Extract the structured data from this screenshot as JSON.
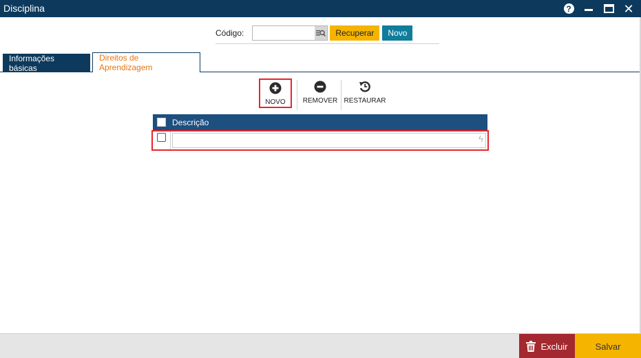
{
  "window": {
    "title": "Disciplina",
    "controls": [
      "help-icon",
      "minimize-icon",
      "maximize-icon",
      "close-icon"
    ]
  },
  "search": {
    "label": "Código:",
    "value": "",
    "placeholder": "",
    "lookup_icon": "lookup-icon",
    "recover_label": "Recuperar",
    "new_label": "Novo"
  },
  "tabs": [
    {
      "label": "Informações básicas",
      "active": false
    },
    {
      "label": "Direitos de Aprendizagem",
      "active": true
    }
  ],
  "toolbar": {
    "items": [
      {
        "label": "NOVO",
        "icon": "plus-circle-icon",
        "highlighted": true
      },
      {
        "label": "REMOVER",
        "icon": "minus-circle-icon"
      },
      {
        "label": "RESTAURAR",
        "icon": "restore-icon"
      }
    ]
  },
  "grid": {
    "columns": [
      "Descrição"
    ],
    "rows": [
      {
        "checked": false,
        "descricao": ""
      }
    ]
  },
  "footer": {
    "delete_label": "Excluir",
    "save_label": "Salvar"
  },
  "colors": {
    "titlebar": "#0d3a5c",
    "accent_yellow": "#f5b400",
    "accent_teal": "#0f7d9c",
    "grid_header": "#1d4f7f",
    "delete_red": "#a3282f",
    "active_tab_text": "#e87511",
    "highlight_red": "#e8242b"
  }
}
